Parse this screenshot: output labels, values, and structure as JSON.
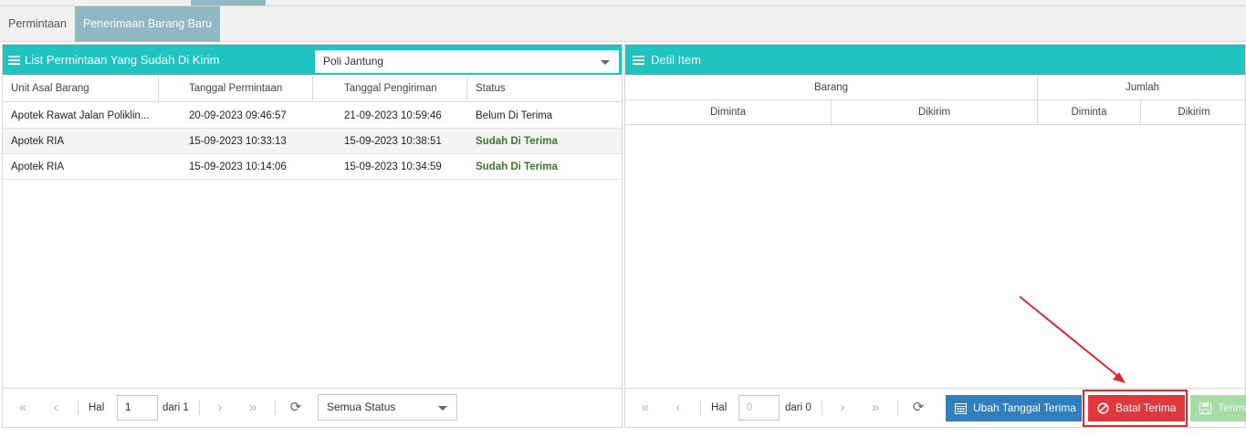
{
  "tabs": [
    {
      "label": "Permintaan",
      "active": false
    },
    {
      "label": "Penerimaan Barang Baru",
      "active": true
    }
  ],
  "left_panel": {
    "title": "List Permintaan Yang Sudah Di Kirim",
    "unit_select": "Poli Jantung",
    "columns": [
      "Unit Asal Barang",
      "Tanggal Permintaan",
      "Tanggal Pengiriman",
      "Status"
    ],
    "rows": [
      [
        "Apotek Rawat Jalan Poliklin...",
        "20-09-2023 09:46:57",
        "21-09-2023 10:59:46",
        "Belum Di Terima"
      ],
      [
        "Apotek RIA",
        "15-09-2023 10:33:13",
        "15-09-2023 10:38:51",
        "Sudah Di Terima"
      ],
      [
        "Apotek RIA",
        "15-09-2023 10:14:06",
        "15-09-2023 10:34:59",
        "Sudah Di Terima"
      ]
    ],
    "pager": {
      "hal_label": "Hal",
      "page": "1",
      "of_label": "dari 1",
      "status_filter": "Semua Status"
    }
  },
  "right_panel": {
    "title": "Detil Item",
    "group_barang": "Barang",
    "group_jumlah": "Jumlah",
    "sub_diminta": "Diminta",
    "sub_dikirim": "Dikirim",
    "pager": {
      "hal_label": "Hal",
      "page": "0",
      "of_label": "dari 0"
    },
    "buttons": {
      "ubah": "Ubah Tanggal Terima",
      "batal": "Batal Terima",
      "terima": "Terima"
    }
  },
  "colors": {
    "header_teal": "#1fc4c0",
    "tab_active": "#8fb7c4",
    "status_received": "#3a7a2b",
    "btn_blue": "#2f7fbf",
    "btn_red": "#e0363e",
    "btn_green_disabled": "#a6dca6",
    "annotation_red": "#e3262b"
  },
  "icons": [
    "list-icon",
    "first-page-icon",
    "prev-page-icon",
    "next-page-icon",
    "last-page-icon",
    "refresh-icon",
    "calendar-icon",
    "ban-icon",
    "save-icon",
    "chevron-down-icon"
  ]
}
